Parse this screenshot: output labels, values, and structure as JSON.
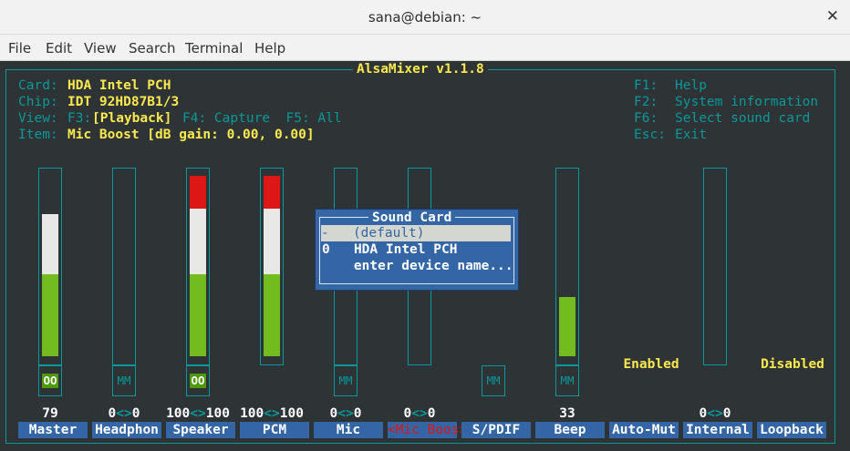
{
  "window": {
    "title": "sana@debian: ~"
  },
  "menu": [
    "File",
    "Edit",
    "View",
    "Search",
    "Terminal",
    "Help"
  ],
  "app": {
    "title": "AlsaMixer v1.1.8",
    "info": {
      "card_label": "Card:",
      "card_value": "HDA Intel PCH",
      "chip_label": "Chip:",
      "chip_value": "IDT 92HD87B1/3",
      "view_label": "View:",
      "view_f3": "F3:",
      "view_playback": "[Playback]",
      "view_rest": "F4: Capture  F5: All",
      "item_label": "Item:",
      "item_value": "Mic Boost [dB gain: 0.00, 0.00]"
    },
    "help": [
      {
        "key": "F1:",
        "text": "Help"
      },
      {
        "key": "F2:",
        "text": "System information"
      },
      {
        "key": "F6:",
        "text": "Select sound card"
      },
      {
        "key": "Esc:",
        "text": "Exit"
      }
    ]
  },
  "channels": [
    {
      "name": "Master",
      "value_left": "79",
      "value_sep": "",
      "value_right": "",
      "level_percent": 79,
      "mute": "OO",
      "active": false
    },
    {
      "name": "Headphon",
      "value_left": "0",
      "value_sep": "<>",
      "value_right": "0",
      "level_percent": 0,
      "mute": "MM",
      "active": false
    },
    {
      "name": "Speaker",
      "value_left": "100",
      "value_sep": "<>",
      "value_right": "100",
      "level_percent": 100,
      "mute": "OO",
      "active": false
    },
    {
      "name": "PCM",
      "value_left": "100",
      "value_sep": "<>",
      "value_right": "100",
      "level_percent": 100,
      "mute": "",
      "active": false
    },
    {
      "name": "Mic",
      "value_left": "0",
      "value_sep": "<>",
      "value_right": "0",
      "level_percent": 0,
      "mute": "MM",
      "active": false
    },
    {
      "name": "<Mic Boos>",
      "value_left": "0",
      "value_sep": "<>",
      "value_right": "0",
      "level_percent": 0,
      "mute": "",
      "active": true
    },
    {
      "name": "S/PDIF",
      "value_left": "",
      "value_sep": "",
      "value_right": "",
      "level_percent": 0,
      "mute": "MM",
      "active": false
    },
    {
      "name": "Beep",
      "value_left": "33",
      "value_sep": "",
      "value_right": "",
      "level_percent": 33,
      "mute": "MM",
      "active": false
    },
    {
      "name": "Auto-Mut",
      "value_left": "",
      "value_sep": "",
      "value_right": "",
      "state": "Enabled",
      "active": false
    },
    {
      "name": "Internal",
      "value_left": "0",
      "value_sep": "<>",
      "value_right": "0",
      "level_percent": 0,
      "mute": "",
      "active": false
    },
    {
      "name": "Loopback",
      "value_left": "",
      "value_sep": "",
      "value_right": "",
      "state": "Disabled",
      "active": false
    }
  ],
  "dialog": {
    "title": "Sound Card",
    "options": [
      {
        "index": "-",
        "label": "(default)",
        "selected": true
      },
      {
        "index": "0",
        "label": "HDA Intel PCH",
        "selected": false
      },
      {
        "index": "",
        "label": "enter device name...",
        "selected": false
      }
    ]
  },
  "colors": {
    "frame": "#06989a",
    "highlight": "#fce94f",
    "volume_green": "#73bc20",
    "volume_white": "#e8e8e6",
    "volume_red": "#dd1616",
    "label_bg": "#3465a4"
  }
}
